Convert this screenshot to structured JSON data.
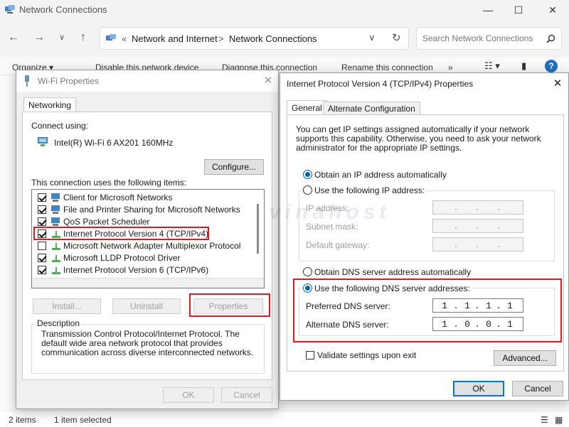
{
  "explorer": {
    "title": "Network Connections",
    "address": {
      "separator": "«",
      "crumbs": [
        "Network and Internet",
        "Network Connections"
      ],
      "crumb_separator": ">"
    },
    "search_placeholder": "Search Network Connections",
    "toolbar": {
      "organize": "Organize ▾",
      "disable": "Disable this network device",
      "diagnose": "Diagnose this connection",
      "rename": "Rename this connection",
      "more": "»"
    },
    "status": {
      "items": "2 items",
      "selected": "1 item selected"
    }
  },
  "wifi_dialog": {
    "title": "Wi-Fi Properties",
    "tab": "Networking",
    "connect_using_label": "Connect using:",
    "adapter": "Intel(R) Wi-Fi 6 AX201 160MHz",
    "configure_btn": "Configure...",
    "items_label": "This connection uses the following items:",
    "items": [
      {
        "label": "Client for Microsoft Networks",
        "checked": true
      },
      {
        "label": "File and Printer Sharing for Microsoft Networks",
        "checked": true
      },
      {
        "label": "QoS Packet Scheduler",
        "checked": true
      },
      {
        "label": "Internet Protocol Version 4 (TCP/IPv4)",
        "checked": true
      },
      {
        "label": "Microsoft Network Adapter Multiplexor Protocol",
        "checked": false
      },
      {
        "label": "Microsoft LLDP Protocol Driver",
        "checked": true
      },
      {
        "label": "Internet Protocol Version 6 (TCP/IPv6)",
        "checked": true
      }
    ],
    "install_btn": "Install...",
    "uninstall_btn": "Uninstall",
    "properties_btn": "Properties",
    "description_title": "Description",
    "description": "Transmission Control Protocol/Internet Protocol. The default wide area network protocol that provides communication across diverse interconnected networks.",
    "ok_btn": "OK",
    "cancel_btn": "Cancel"
  },
  "ipv4_dialog": {
    "title": "Internet Protocol Version 4 (TCP/IPv4) Properties",
    "tabs": [
      "General",
      "Alternate Configuration"
    ],
    "intro": "You can get IP settings assigned automatically if your network supports this capability. Otherwise, you need to ask your network administrator for the appropriate IP settings.",
    "obtain_ip_auto": "Obtain an IP address automatically",
    "use_following_ip": "Use the following IP address:",
    "ip_address_label": "IP address:",
    "subnet_label": "Subnet mask:",
    "gateway_label": "Default gateway:",
    "obtain_dns_auto": "Obtain DNS server address automatically",
    "use_following_dns": "Use the following DNS server addresses:",
    "preferred_dns_label": "Preferred DNS server:",
    "preferred_dns": [
      "1",
      "1",
      "1",
      "1"
    ],
    "alternate_dns_label": "Alternate DNS server:",
    "alternate_dns": [
      "1",
      "0",
      "0",
      "1"
    ],
    "validate_label": "Validate settings upon exit",
    "advanced_btn": "Advanced...",
    "ok_btn": "OK",
    "cancel_btn": "Cancel"
  },
  "watermark": "vinahost",
  "colors": {
    "highlight": "#e01b24",
    "accent": "#0078d7"
  }
}
